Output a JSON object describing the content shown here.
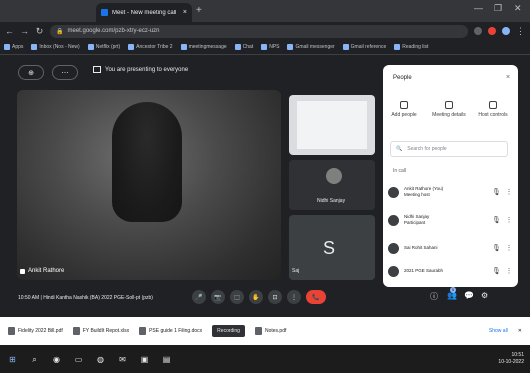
{
  "browser": {
    "tab_title": "Meet - New meeting call",
    "new_tab": "+",
    "url": "meet.google.com/pzb-xtry-ecz-uzn",
    "bookmarks": [
      "Apps",
      "Inbox (Nos - New)",
      "Netflix (prt)",
      "Ancestor Tribe 2",
      "meetingmessage",
      "Chat",
      "NPS",
      "Gmail messenger",
      "Gmail reference",
      "Reading list"
    ],
    "window_controls": [
      "—",
      "❐",
      "✕"
    ]
  },
  "meet": {
    "top_buttons": [
      "⊕",
      "⋯"
    ],
    "presenting_message": "You are presenting to everyone",
    "main_participant": "Ankit Rathore",
    "tile2_name": "Nidhi Sanjay",
    "tile3_letter": "S",
    "tile3_name": "Saj",
    "meeting_info": "10:50 AM  |  Hindi Kantha Nashik (BA) 2022 PGE-Soll-pt (pzb)",
    "controls": [
      "🎤",
      "📷",
      "⬚",
      "✋",
      "⊡",
      "⋮",
      "📞"
    ],
    "right_controls": [
      "ⓘ",
      "👥",
      "💬",
      "⚙"
    ],
    "people_badge": "5"
  },
  "panel": {
    "title": "People",
    "close": "×",
    "actions": [
      {
        "label": "Add people",
        "icon": "add-person-icon"
      },
      {
        "label": "Meeting details",
        "icon": "details-icon"
      },
      {
        "label": "Host controls",
        "icon": "host-controls-icon"
      }
    ],
    "search_placeholder": "Search for people",
    "section_label": "In call",
    "people": [
      {
        "name": "Ankit Rathore (You)",
        "sub": "Meeting host"
      },
      {
        "name": "Nidhi Sanjay",
        "sub": "Participant"
      },
      {
        "name": "Sai Rohit Sahani",
        "sub": ""
      },
      {
        "name": "2021 PGE Saurabh",
        "sub": ""
      }
    ]
  },
  "downloads": {
    "items": [
      "Fidelity 2022 Bill.pdf",
      "FY BuildIt Repot.xlsx",
      "PSE guide 1 Filing.docx",
      "Recording",
      "Notes.pdf"
    ],
    "show_all": "Show all"
  },
  "taskbar": {
    "time": "10:51",
    "date": "10-10-2022"
  },
  "colors": {
    "accent": "#1a73e8",
    "end_call": "#ea4335",
    "bg": "#202124"
  }
}
